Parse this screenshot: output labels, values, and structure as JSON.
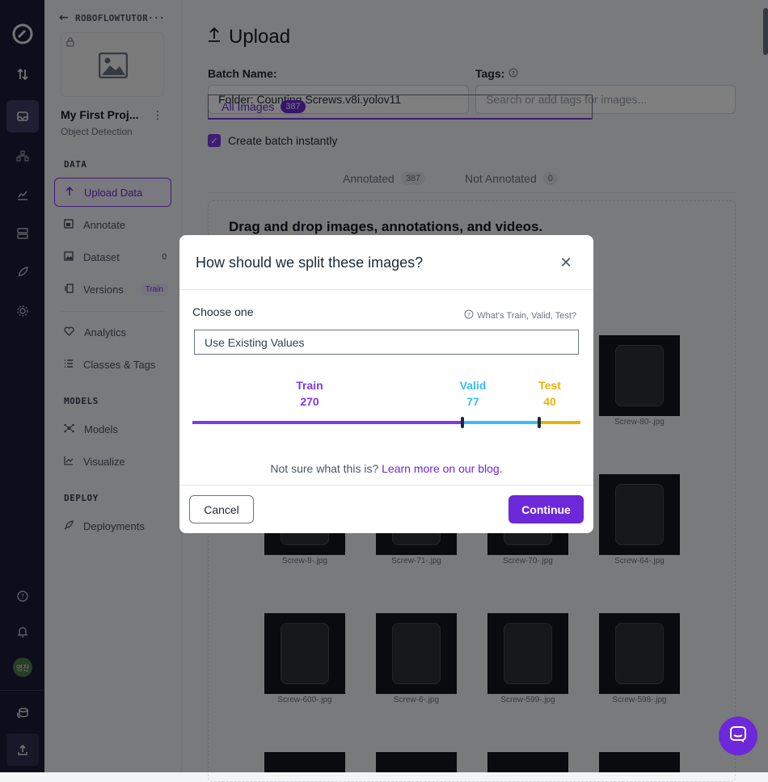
{
  "sidebar": {
    "back_label": "ROBOFLOWTUTOR···",
    "project_name": "My First Proj...",
    "project_type": "Object Detection",
    "sections": {
      "data": "DATA",
      "models": "MODELS",
      "deploy": "DEPLOY"
    },
    "items": {
      "upload": "Upload Data",
      "annotate": "Annotate",
      "dataset": "Dataset",
      "dataset_count": "0",
      "versions": "Versions",
      "versions_badge": "Train",
      "analytics": "Analytics",
      "classes": "Classes & Tags",
      "models": "Models",
      "visualize": "Visualize",
      "deployments": "Deployments"
    },
    "avatar_text": "영찬"
  },
  "main": {
    "title": "Upload",
    "batch_label": "Batch Name:",
    "batch_value": "Folder: Counting Screws.v8i.yolov11",
    "tags_label": "Tags:",
    "tags_placeholder": "Search or add tags for images...",
    "create_batch": "Create batch instantly",
    "tabs": [
      {
        "label": "All Images",
        "count": "387"
      },
      {
        "label": "Annotated",
        "count": "387"
      },
      {
        "label": "Not Annotated",
        "count": "0"
      }
    ],
    "drop_text": "Drag and drop images, annotations, and videos.",
    "images": [
      "Screw-80-.jpg",
      "Screw-8-.jpg",
      "Screw-71-.jpg",
      "Screw-70-.jpg",
      "Screw-64-.jpg",
      "Screw-600-.jpg",
      "Screw-6-.jpg",
      "Screw-599-.jpg",
      "Screw-598-.jpg"
    ]
  },
  "modal": {
    "title": "How should we split these images?",
    "choose_label": "Choose one",
    "help_link": "What's Train, Valid, Test?",
    "select_value": "Use Existing Values",
    "split": {
      "train": {
        "label": "Train",
        "value": "270"
      },
      "valid": {
        "label": "Valid",
        "value": "77"
      },
      "test": {
        "label": "Test",
        "value": "40"
      }
    },
    "note_text": "Not sure what this is?",
    "note_link": "Learn more on our blog.",
    "cancel": "Cancel",
    "continue": "Continue"
  },
  "colors": {
    "accent": "#6d28d9",
    "train": "#7c3aed",
    "valid": "#38bdf8",
    "test": "#eab308"
  }
}
